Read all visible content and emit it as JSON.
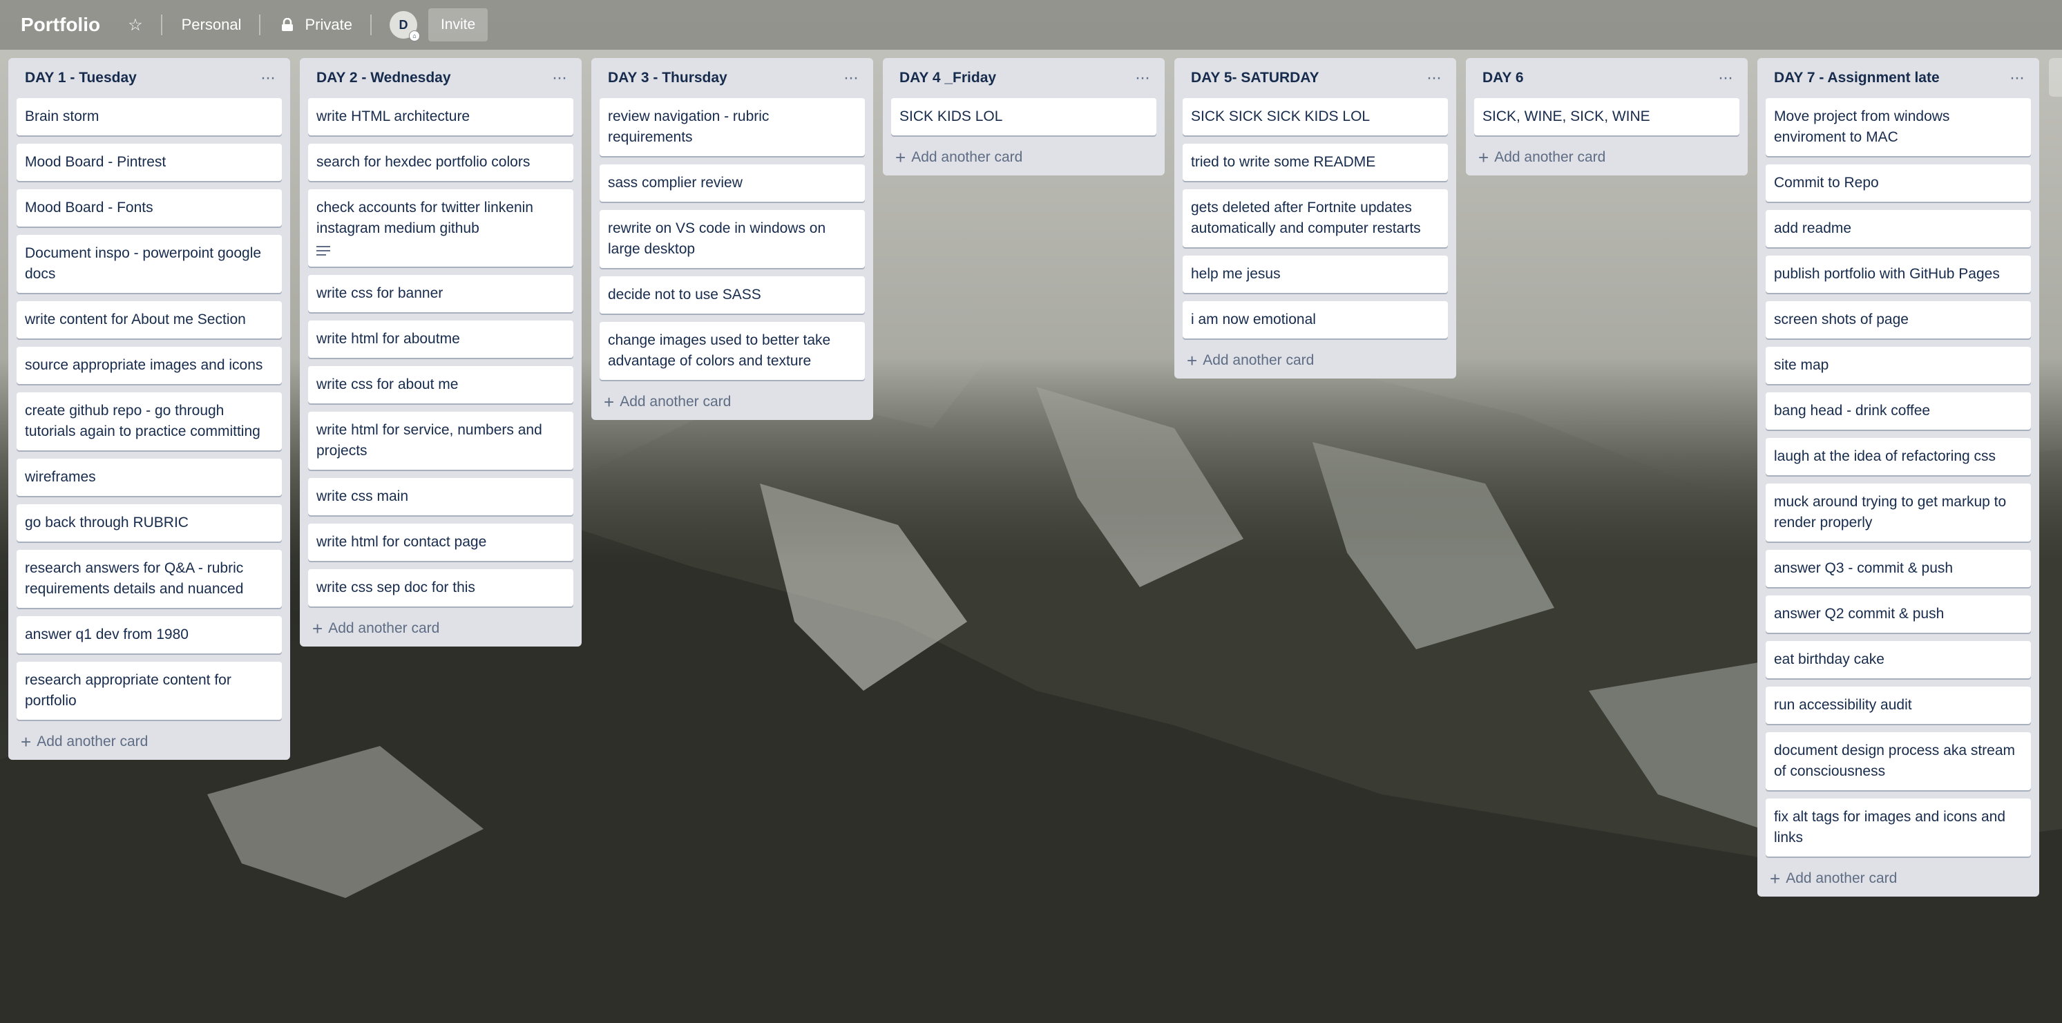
{
  "header": {
    "title": "Portfolio",
    "team": "Personal",
    "visibility": "Private",
    "avatar_initial": "D",
    "invite": "Invite"
  },
  "add_card_label": "Add another card",
  "lists": [
    {
      "title": "DAY 1 - Tuesday",
      "cards": [
        "Brain storm",
        "Mood Board - Pintrest",
        "Mood Board - Fonts",
        "Document inspo - powerpoint google docs",
        "write content for About me Section",
        "source appropriate images and icons",
        "create github repo - go through tutorials again to practice committing",
        "wireframes",
        "go back through RUBRIC",
        "research answers for Q&A - rubric requirements details and nuanced",
        "answer q1 dev from 1980",
        "research appropriate content for portfolio"
      ]
    },
    {
      "title": "DAY 2 - Wednesday",
      "cards": [
        "write HTML architecture",
        "search for hexdec portfolio colors",
        "check accounts for twitter linkenin instagram medium github",
        "write css for banner",
        "write html for aboutme",
        "write css for about me",
        "write html for service, numbers and projects",
        "write css main",
        "write html for contact page",
        "write css sep doc for this"
      ]
    },
    {
      "title": "DAY 3 - Thursday",
      "cards": [
        "review navigation - rubric requirements",
        "sass complier review",
        "rewrite on VS code in windows on large desktop",
        "decide not to use SASS",
        "change images used to better take advantage of colors and texture"
      ]
    },
    {
      "title": "DAY 4 _Friday",
      "cards": [
        "SICK KIDS LOL"
      ]
    },
    {
      "title": "DAY 5- SATURDAY",
      "cards": [
        "SICK SICK SICK KIDS LOL",
        "tried to write some README",
        "gets deleted after Fortnite updates automatically and computer restarts",
        "help me jesus",
        "i am now emotional"
      ]
    },
    {
      "title": "DAY 6",
      "cards": [
        "SICK, WINE, SICK, WINE"
      ]
    },
    {
      "title": "DAY 7 - Assignment late",
      "cards": [
        "Move project from windows enviroment to MAC",
        "Commit to Repo",
        "add readme",
        "publish portfolio with GitHub Pages",
        "screen shots of page",
        "site map",
        "bang head - drink coffee",
        "laugh at the idea of refactoring css",
        "muck around trying to get markup to render properly",
        "answer Q3 - commit & push",
        "answer Q2 commit & push",
        "eat birthday cake",
        "run accessibility audit",
        "document design process aka stream of consciousness",
        "fix alt tags for images and icons and links"
      ]
    }
  ]
}
